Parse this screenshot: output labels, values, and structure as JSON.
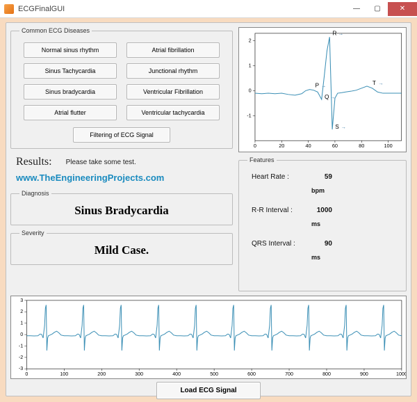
{
  "window": {
    "title": "ECGFinalGUI",
    "min": "—",
    "max": "▢",
    "close": "✕"
  },
  "diseases": {
    "legend": "Common ECG Diseases",
    "buttons": [
      "Normal sinus rhythm",
      "Atrial fibrillation",
      "Sinus Tachycardia",
      "Junctional rhythm",
      "Sinus bradycardia",
      "Ventricular Fibrillation",
      "Atrial flutter",
      "Ventricular tachycardia"
    ],
    "filter_button": "Filtering of ECG Signal"
  },
  "results": {
    "label": "Results:",
    "message": "Please take some test.",
    "website": "www.TheEngineeringProjects.com"
  },
  "diagnosis": {
    "legend": "Diagnosis",
    "value": "Sinus Bradycardia"
  },
  "severity": {
    "legend": "Severity",
    "value": "Mild Case."
  },
  "features": {
    "legend": "Features",
    "rows": [
      {
        "label": "Heart Rate :",
        "value": "59",
        "unit": "bpm"
      },
      {
        "label": "R-R Interval :",
        "value": "1000",
        "unit": "ms"
      },
      {
        "label": "QRS Interval :",
        "value": "90",
        "unit": "ms"
      }
    ]
  },
  "load_button": "Load ECG Signal",
  "chart_data": [
    {
      "type": "line",
      "title": "",
      "xlabel": "",
      "ylabel": "",
      "xlim": [
        0,
        110
      ],
      "ylim": [
        -2,
        2.3
      ],
      "xticks": [
        0,
        20,
        40,
        60,
        80,
        100
      ],
      "yticks": [
        -1,
        0,
        1,
        2
      ],
      "annotations": [
        {
          "label": "P",
          "x": 43,
          "y": 0.05
        },
        {
          "label": "Q",
          "x": 50,
          "y": -0.4
        },
        {
          "label": "R",
          "x": 56,
          "y": 2.15
        },
        {
          "label": "S",
          "x": 58,
          "y": -1.6
        },
        {
          "label": "T",
          "x": 86,
          "y": 0.15
        }
      ],
      "series": [
        {
          "name": "beat",
          "color": "#3b8fb5",
          "x": [
            0,
            5,
            10,
            15,
            20,
            25,
            30,
            35,
            38,
            41,
            44,
            47,
            50,
            52,
            54,
            56,
            58,
            60,
            62,
            65,
            68,
            72,
            76,
            80,
            84,
            88,
            92,
            96,
            100,
            105,
            110
          ],
          "y": [
            -0.1,
            -0.12,
            -0.1,
            -0.12,
            -0.1,
            -0.15,
            -0.18,
            -0.12,
            0.0,
            0.05,
            0.02,
            -0.05,
            -0.35,
            0.6,
            1.6,
            2.15,
            -1.55,
            -0.3,
            -0.1,
            -0.08,
            -0.05,
            -0.02,
            0.02,
            0.1,
            0.18,
            0.1,
            -0.05,
            -0.1,
            -0.1,
            -0.1,
            -0.1
          ]
        }
      ]
    },
    {
      "type": "line",
      "title": "",
      "xlabel": "",
      "ylabel": "",
      "xlim": [
        0,
        1000
      ],
      "ylim": [
        -3,
        3
      ],
      "xticks": [
        0,
        100,
        200,
        300,
        400,
        500,
        600,
        700,
        800,
        900,
        1000
      ],
      "yticks": [
        -3,
        -2,
        -1,
        0,
        1,
        2,
        3
      ],
      "period": 100,
      "n_beats": 10,
      "series": [
        {
          "name": "ecg",
          "color": "#3b8fb5",
          "x": [
            0,
            10,
            20,
            30,
            36,
            40,
            44,
            48,
            50,
            52,
            54,
            56,
            58,
            62,
            68,
            74,
            80,
            86,
            92,
            100
          ],
          "y": [
            -0.1,
            -0.1,
            -0.12,
            -0.1,
            0.05,
            0.02,
            -0.3,
            0.8,
            2.3,
            2.6,
            -1.4,
            -0.3,
            -0.1,
            -0.05,
            0.05,
            0.2,
            0.3,
            0.15,
            -0.05,
            -0.1
          ]
        }
      ]
    }
  ]
}
